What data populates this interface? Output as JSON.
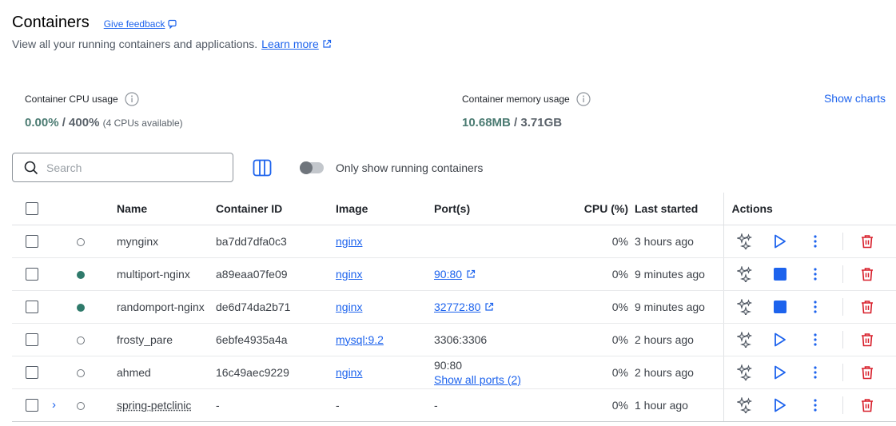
{
  "header": {
    "title": "Containers",
    "feedback": "Give feedback",
    "subtitle": "View all your running containers and applications.",
    "learn_more": "Learn more"
  },
  "stats": {
    "cpu_label": "Container CPU usage",
    "cpu_value": "0.00%",
    "cpu_total": " / 400%",
    "cpu_note": "(4 CPUs available)",
    "mem_label": "Container memory usage",
    "mem_value": "10.68MB",
    "mem_total": " / 3.71GB",
    "show_charts": "Show charts"
  },
  "toolbar": {
    "search_placeholder": "Search",
    "toggle_label": "Only show running containers"
  },
  "columns": [
    "Name",
    "Container ID",
    "Image",
    "Port(s)",
    "CPU (%)",
    "Last started",
    "Actions"
  ],
  "rows": [
    {
      "name": "mynginx",
      "id": "ba7dd7dfa0c3",
      "image": "nginx",
      "port": "",
      "port2": "",
      "cpu": "0%",
      "started": "3 hours ago",
      "status": "stopped"
    },
    {
      "name": "multiport-nginx",
      "id": "a89eaa07fe09",
      "image": "nginx",
      "port": "90:80",
      "port2": "",
      "cpu": "0%",
      "started": "9 minutes ago",
      "status": "running"
    },
    {
      "name": "randomport-nginx",
      "id": "de6d74da2b71",
      "image": "nginx",
      "port": "32772:80",
      "port2": "",
      "cpu": "0%",
      "started": "9 minutes ago",
      "status": "running"
    },
    {
      "name": "frosty_pare",
      "id": "6ebfe4935a4a",
      "image": "mysql:9.2",
      "port": "3306:3306",
      "port2": "",
      "cpu": "0%",
      "started": "2 hours ago",
      "status": "stopped"
    },
    {
      "name": "ahmed",
      "id": "16c49aec9229",
      "image": "nginx",
      "port": "90:80",
      "port2": "Show all ports (2)",
      "cpu": "0%",
      "started": "2 hours ago",
      "status": "stopped"
    },
    {
      "name": "spring-petclinic",
      "id": "-",
      "image": "-",
      "port": "-",
      "port2": "",
      "cpu": "0%",
      "started": "1 hour ago",
      "status": "stopped"
    }
  ]
}
